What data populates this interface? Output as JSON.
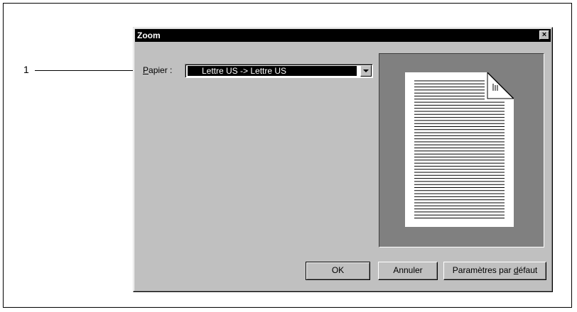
{
  "callout": {
    "number": "1"
  },
  "dialog": {
    "title": "Zoom",
    "close_symbol": "×",
    "paper_label_accel": "P",
    "paper_label_rest": "apier :",
    "paper_value": "Lettre US -> Lettre US",
    "buttons": {
      "ok": "OK",
      "cancel": "Annuler",
      "defaults_prefix": "Paramètres par ",
      "defaults_accel": "d",
      "defaults_suffix": "éfaut"
    },
    "preview_icon": "document-page-icon"
  }
}
